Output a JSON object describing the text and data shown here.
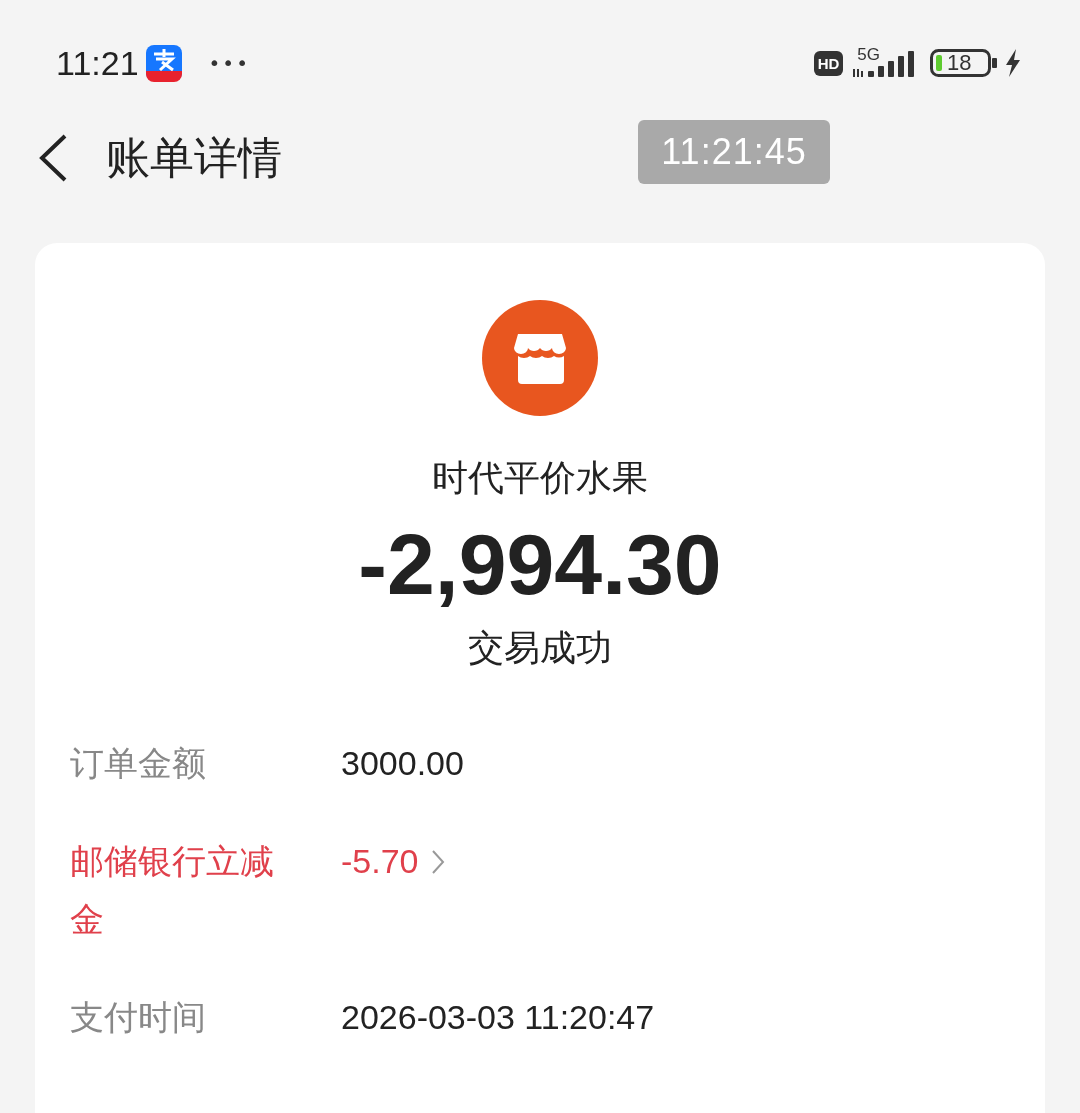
{
  "status_bar": {
    "time": "11:21",
    "more": "•••",
    "hd": "HD",
    "network": "5G",
    "battery": "18"
  },
  "header": {
    "title": "账单详情",
    "timestamp": "11:21:45"
  },
  "merchant": {
    "name": "时代平价水果",
    "amount": "-2,994.30",
    "status": "交易成功"
  },
  "details": [
    {
      "kind": "normal",
      "label": "订单金额",
      "value": "3000.00"
    },
    {
      "kind": "discount",
      "label": "邮储银行立减金",
      "value": "-5.70"
    },
    {
      "kind": "normal",
      "label": "支付时间",
      "value": "2026-03-03 11:20:47"
    }
  ]
}
